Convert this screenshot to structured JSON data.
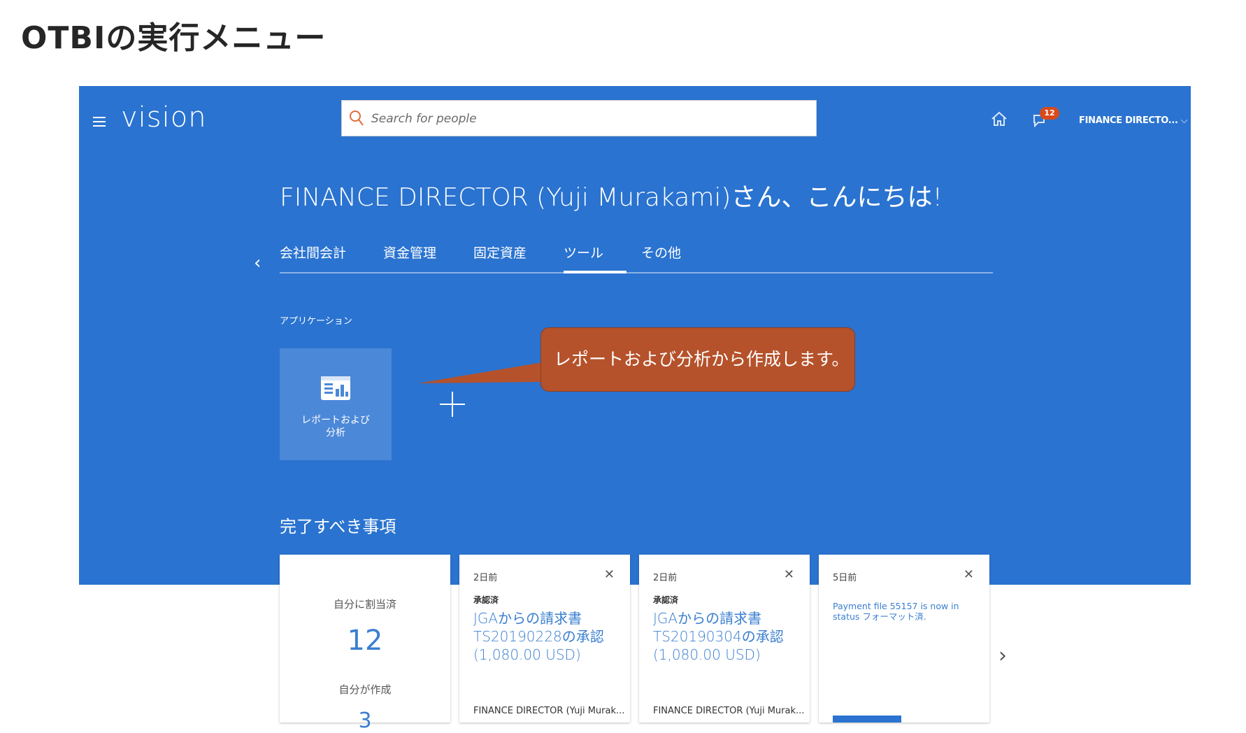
{
  "slide_title": "OTBIの実行メニュー",
  "header": {
    "logo": "vision",
    "search_placeholder": "Search for people",
    "notification_count": "12",
    "user_label": "FINANCE DIRECTO...",
    "user_chevron": "⌵"
  },
  "greeting": "FINANCE DIRECTOR (Yuji Murakami)さん、こんにちは!",
  "tabs": [
    {
      "label": "会社間会計",
      "active": false
    },
    {
      "label": "資金管理",
      "active": false
    },
    {
      "label": "固定資産",
      "active": false
    },
    {
      "label": "ツール",
      "active": true
    },
    {
      "label": "その他",
      "active": false
    }
  ],
  "applications": {
    "section_label": "アプリケーション",
    "tile_label": "レポートおよび\n分析"
  },
  "callout": "レポートおよび分析から作成します。",
  "todo": {
    "title": "完了すべき事項",
    "summary": {
      "assigned_label": "自分に割当済",
      "assigned_count": "12",
      "created_label": "自分が作成",
      "created_count": "3"
    },
    "cards": [
      {
        "when": "2日前",
        "status": "承認済",
        "subject": "JGAからの請求書 TS20190228の承認 (1,080.00 USD)",
        "footer": "FINANCE DIRECTOR (Yuji Murak..."
      },
      {
        "when": "2日前",
        "status": "承認済",
        "subject": "JGAからの請求書 TS20190304の承認 (1,080.00 USD)",
        "footer": "FINANCE DIRECTOR (Yuji Murak..."
      },
      {
        "when": "5日前",
        "message": "Payment file 55157 is now in status フォーマット済."
      }
    ],
    "close_glyph": "✕",
    "next_glyph": "›",
    "prev_glyph": "‹"
  },
  "colors": {
    "app_blue": "#2a73d0",
    "tile_blue": "#4c88d8",
    "callout": "#b5522b",
    "badge": "#d84a1b"
  }
}
